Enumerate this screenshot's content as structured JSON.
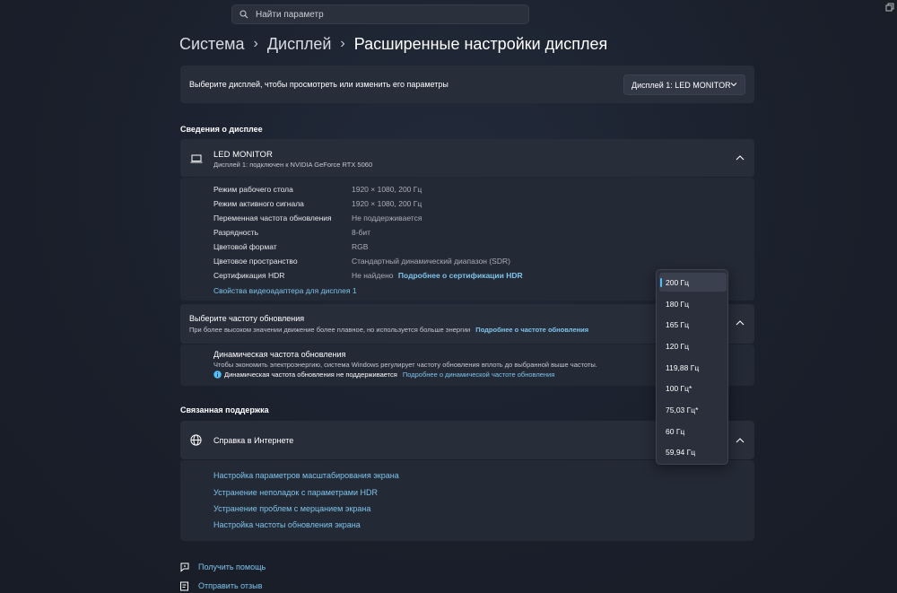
{
  "search": {
    "placeholder": "Найти параметр"
  },
  "breadcrumb": {
    "item1": "Система",
    "item2": "Дисплей",
    "current": "Расширенные настройки дисплея"
  },
  "display_select": {
    "prompt": "Выберите дисплей, чтобы просмотреть или изменить его параметры",
    "value": "Дисплей 1: LED MONITOR"
  },
  "display_info": {
    "section_title": "Сведения о дисплее",
    "monitor_name": "LED MONITOR",
    "monitor_subtitle": "Дисплей 1: подключен к NVIDIA GeForce RTX 5060",
    "rows": [
      {
        "label": "Режим рабочего стола",
        "value": "1920 × 1080, 200 Гц"
      },
      {
        "label": "Режим активного сигнала",
        "value": "1920 × 1080, 200 Гц"
      },
      {
        "label": "Переменная частота обновления",
        "value": "Не поддерживается"
      },
      {
        "label": "Разрядность",
        "value": "8-бит"
      },
      {
        "label": "Цветовой формат",
        "value": "RGB"
      },
      {
        "label": "Цветовое пространство",
        "value": "Стандартный динамический диапазон (SDR)"
      },
      {
        "label": "Сертификация HDR",
        "value": "Не найдено"
      }
    ],
    "hdr_link": "Подробнее о сертификации HDR",
    "adapter_link": "Свойства видеоадаптера для дисплея 1"
  },
  "refresh": {
    "title": "Выберите частоту обновления",
    "description": "При более высоком значении движение более плавное, но используется больше энергии",
    "more_link": "Подробнее о частоте обновления",
    "dynamic_title": "Динамическая частота обновления",
    "dynamic_desc": "Чтобы экономить электроэнергию, система Windows регулирует частоту обновления вплоть до выбранной выше частоты.",
    "dynamic_status": "Динамическая частота обновления не поддерживается",
    "dynamic_link": "Подробнее о динамической частоте обновления",
    "options": [
      "200 Гц",
      "180 Гц",
      "165 Гц",
      "120 Гц",
      "119,88 Гц",
      "100 Гц*",
      "75,03 Гц*",
      "60 Гц",
      "59,94 Гц"
    ],
    "selected": "200 Гц"
  },
  "support": {
    "section_title": "Связанная поддержка",
    "help_title": "Справка в Интернете",
    "links": [
      "Настройка параметров масштабирования экрана",
      "Устранение неполадок с параметрами HDR",
      "Устранение проблем с мерцанием экрана",
      "Настройка частоты обновления экрана"
    ]
  },
  "footer": {
    "get_help": "Получить помощь",
    "feedback": "Отправить отзыв"
  },
  "colors": {
    "accent": "#4cc2ff",
    "link": "#7fc4ec",
    "card": "#272d39",
    "background": "#1c2230"
  }
}
